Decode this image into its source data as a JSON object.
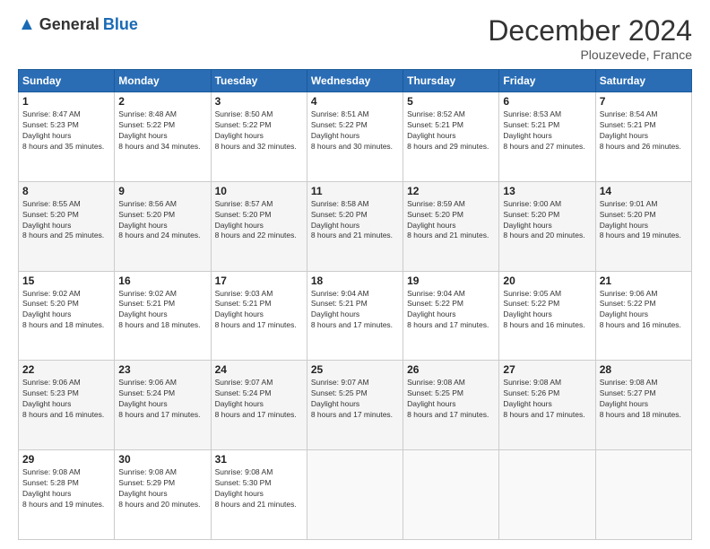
{
  "header": {
    "logo_general": "General",
    "logo_blue": "Blue",
    "month_title": "December 2024",
    "location": "Plouzevede, France"
  },
  "days_of_week": [
    "Sunday",
    "Monday",
    "Tuesday",
    "Wednesday",
    "Thursday",
    "Friday",
    "Saturday"
  ],
  "weeks": [
    [
      {
        "day": "1",
        "sunrise": "8:47 AM",
        "sunset": "5:23 PM",
        "daylight": "8 hours and 35 minutes."
      },
      {
        "day": "2",
        "sunrise": "8:48 AM",
        "sunset": "5:22 PM",
        "daylight": "8 hours and 34 minutes."
      },
      {
        "day": "3",
        "sunrise": "8:50 AM",
        "sunset": "5:22 PM",
        "daylight": "8 hours and 32 minutes."
      },
      {
        "day": "4",
        "sunrise": "8:51 AM",
        "sunset": "5:22 PM",
        "daylight": "8 hours and 30 minutes."
      },
      {
        "day": "5",
        "sunrise": "8:52 AM",
        "sunset": "5:21 PM",
        "daylight": "8 hours and 29 minutes."
      },
      {
        "day": "6",
        "sunrise": "8:53 AM",
        "sunset": "5:21 PM",
        "daylight": "8 hours and 27 minutes."
      },
      {
        "day": "7",
        "sunrise": "8:54 AM",
        "sunset": "5:21 PM",
        "daylight": "8 hours and 26 minutes."
      }
    ],
    [
      {
        "day": "8",
        "sunrise": "8:55 AM",
        "sunset": "5:20 PM",
        "daylight": "8 hours and 25 minutes."
      },
      {
        "day": "9",
        "sunrise": "8:56 AM",
        "sunset": "5:20 PM",
        "daylight": "8 hours and 24 minutes."
      },
      {
        "day": "10",
        "sunrise": "8:57 AM",
        "sunset": "5:20 PM",
        "daylight": "8 hours and 22 minutes."
      },
      {
        "day": "11",
        "sunrise": "8:58 AM",
        "sunset": "5:20 PM",
        "daylight": "8 hours and 21 minutes."
      },
      {
        "day": "12",
        "sunrise": "8:59 AM",
        "sunset": "5:20 PM",
        "daylight": "8 hours and 21 minutes."
      },
      {
        "day": "13",
        "sunrise": "9:00 AM",
        "sunset": "5:20 PM",
        "daylight": "8 hours and 20 minutes."
      },
      {
        "day": "14",
        "sunrise": "9:01 AM",
        "sunset": "5:20 PM",
        "daylight": "8 hours and 19 minutes."
      }
    ],
    [
      {
        "day": "15",
        "sunrise": "9:02 AM",
        "sunset": "5:20 PM",
        "daylight": "8 hours and 18 minutes."
      },
      {
        "day": "16",
        "sunrise": "9:02 AM",
        "sunset": "5:21 PM",
        "daylight": "8 hours and 18 minutes."
      },
      {
        "day": "17",
        "sunrise": "9:03 AM",
        "sunset": "5:21 PM",
        "daylight": "8 hours and 17 minutes."
      },
      {
        "day": "18",
        "sunrise": "9:04 AM",
        "sunset": "5:21 PM",
        "daylight": "8 hours and 17 minutes."
      },
      {
        "day": "19",
        "sunrise": "9:04 AM",
        "sunset": "5:22 PM",
        "daylight": "8 hours and 17 minutes."
      },
      {
        "day": "20",
        "sunrise": "9:05 AM",
        "sunset": "5:22 PM",
        "daylight": "8 hours and 16 minutes."
      },
      {
        "day": "21",
        "sunrise": "9:06 AM",
        "sunset": "5:22 PM",
        "daylight": "8 hours and 16 minutes."
      }
    ],
    [
      {
        "day": "22",
        "sunrise": "9:06 AM",
        "sunset": "5:23 PM",
        "daylight": "8 hours and 16 minutes."
      },
      {
        "day": "23",
        "sunrise": "9:06 AM",
        "sunset": "5:24 PM",
        "daylight": "8 hours and 17 minutes."
      },
      {
        "day": "24",
        "sunrise": "9:07 AM",
        "sunset": "5:24 PM",
        "daylight": "8 hours and 17 minutes."
      },
      {
        "day": "25",
        "sunrise": "9:07 AM",
        "sunset": "5:25 PM",
        "daylight": "8 hours and 17 minutes."
      },
      {
        "day": "26",
        "sunrise": "9:08 AM",
        "sunset": "5:25 PM",
        "daylight": "8 hours and 17 minutes."
      },
      {
        "day": "27",
        "sunrise": "9:08 AM",
        "sunset": "5:26 PM",
        "daylight": "8 hours and 17 minutes."
      },
      {
        "day": "28",
        "sunrise": "9:08 AM",
        "sunset": "5:27 PM",
        "daylight": "8 hours and 18 minutes."
      }
    ],
    [
      {
        "day": "29",
        "sunrise": "9:08 AM",
        "sunset": "5:28 PM",
        "daylight": "8 hours and 19 minutes."
      },
      {
        "day": "30",
        "sunrise": "9:08 AM",
        "sunset": "5:29 PM",
        "daylight": "8 hours and 20 minutes."
      },
      {
        "day": "31",
        "sunrise": "9:08 AM",
        "sunset": "5:30 PM",
        "daylight": "8 hours and 21 minutes."
      },
      null,
      null,
      null,
      null
    ]
  ]
}
